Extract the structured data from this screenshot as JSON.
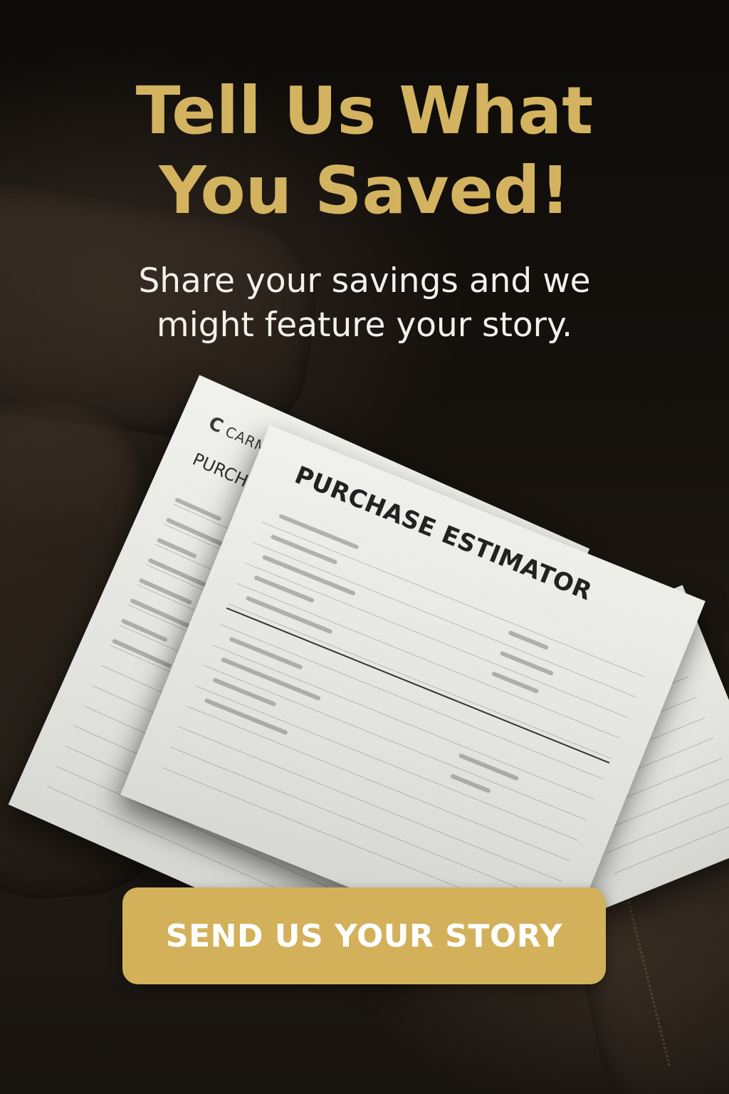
{
  "hero": {
    "headline_line1": "Tell Us What",
    "headline_line2": "You Saved!",
    "subtitle_line1": "Share your savings and we",
    "subtitle_line2": "might feature your story."
  },
  "documents": {
    "back_brand": "CARMANDLET",
    "back_brand_mark": "C",
    "back_title": "PURCHASE",
    "front_title": "PURCHASE ESTIMATOR"
  },
  "cta": {
    "label": "SEND US YOUR STORY"
  },
  "colors": {
    "accent_gold": "#d4b360",
    "button_gold": "#d3b15a",
    "background_dark": "#120f0c",
    "text_light": "#f4f1ea"
  }
}
